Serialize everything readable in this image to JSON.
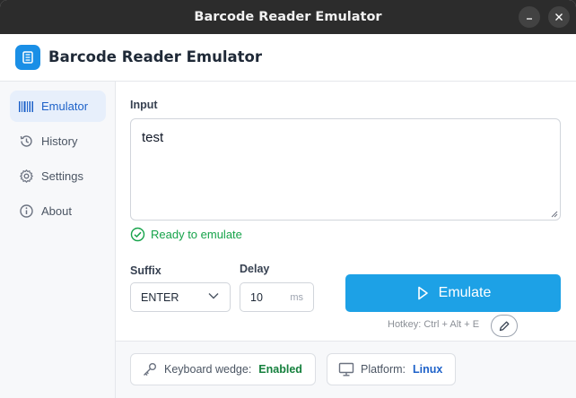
{
  "window": {
    "title": "Barcode Reader Emulator"
  },
  "app": {
    "title": "Barcode Reader Emulator"
  },
  "sidebar": {
    "items": [
      {
        "label": "Emulator",
        "icon": "barcode-icon",
        "active": true
      },
      {
        "label": "History",
        "icon": "history-icon",
        "active": false
      },
      {
        "label": "Settings",
        "icon": "gear-icon",
        "active": false
      },
      {
        "label": "About",
        "icon": "info-icon",
        "active": false
      }
    ]
  },
  "main": {
    "input_label": "Input",
    "input_value": "test",
    "status_text": "Ready to emulate",
    "suffix_label": "Suffix",
    "suffix_value": "ENTER",
    "delay_label": "Delay",
    "delay_value": "10",
    "delay_unit": "ms",
    "emulate_label": "Emulate",
    "hotkey_text": "Hotkey: Ctrl + Alt + E"
  },
  "footer": {
    "wedge_label": "Keyboard wedge:",
    "wedge_value": "Enabled",
    "platform_label": "Platform:",
    "platform_value": "Linux"
  },
  "colors": {
    "accent": "#1da1e6",
    "active_nav": "#1e62c9",
    "success": "#16a34a",
    "titlebar": "#2c2c2c"
  }
}
